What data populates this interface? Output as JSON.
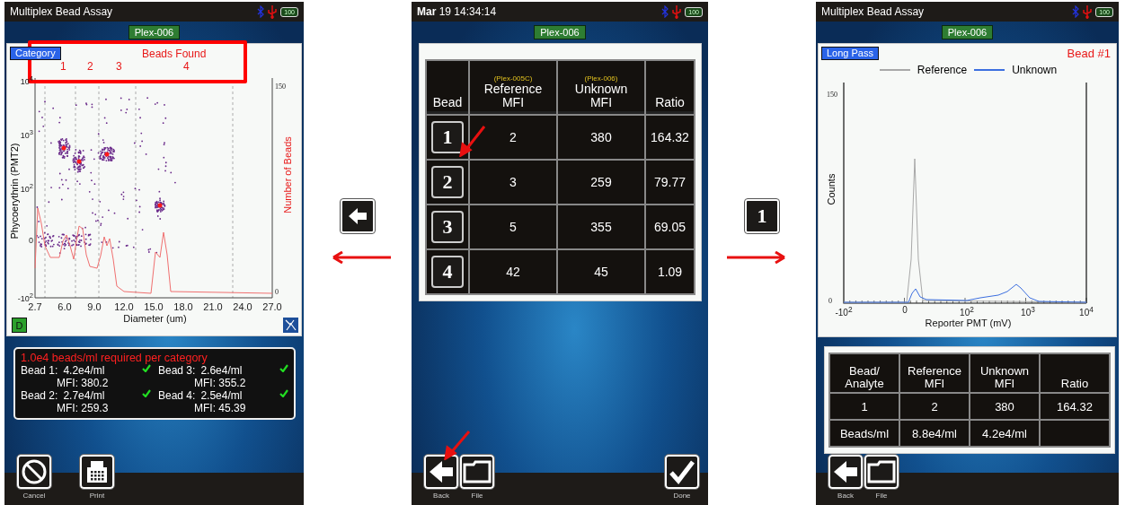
{
  "left_screen": {
    "status_bar": {
      "title": "Multiplex Bead Assay",
      "battery": "100"
    },
    "tag": "Plex-006",
    "plot": {
      "mode_button": "Category",
      "beads_found_label": "Beads Found",
      "bead_markers": [
        "1",
        "2",
        "3",
        "4"
      ],
      "y_label": "Phycoerythrin (PMT2)",
      "y_ticks": [
        "10$^{4}$",
        "10$^{3}$",
        "10$^{2}$",
        "0",
        "-10$^{2}$"
      ],
      "right_label": "Number of Beads",
      "right_ticks": [
        "150",
        "0"
      ],
      "x_ticks": [
        "2.7",
        "6.0",
        "9.0",
        "12.0",
        "15.0",
        "18.0",
        "21.0",
        "24.0",
        "27.0"
      ],
      "x_label": "Diameter (um)",
      "d_button": "D"
    },
    "summary": {
      "requirement": "1.0e4 beads/ml required per category",
      "beads": [
        {
          "label": "Bead 1:",
          "concentration": "4.2e4/ml",
          "mfi": "MFI: 380.2",
          "ok": true
        },
        {
          "label": "Bead 3:",
          "concentration": "2.6e4/ml",
          "mfi": "MFI: 355.2",
          "ok": true
        },
        {
          "label": "Bead 2:",
          "concentration": "2.7e4/ml",
          "mfi": "MFI: 259.3",
          "ok": true
        },
        {
          "label": "Bead 4:",
          "concentration": "2.5e4/ml",
          "mfi": "MFI: 45.39",
          "ok": true
        }
      ]
    },
    "toolbar": [
      {
        "kind": "cancel",
        "label": "Cancel"
      },
      {
        "kind": "print",
        "label": "Print"
      }
    ]
  },
  "connectors": [
    {
      "kind": "back"
    },
    {
      "kind": "number",
      "label": "1"
    }
  ],
  "middle_screen": {
    "status_bar": {
      "title": "**Mar** 19 14:34:14",
      "battery": "100"
    },
    "tag": "Plex-006",
    "table": {
      "columns": [
        {
          "title": "Bead"
        },
        {
          "sublabel": "(Plex-005C)",
          "title": "Reference MFI"
        },
        {
          "sublabel": "(Plex-006)",
          "title": "Unknown MFI"
        },
        {
          "title": "Ratio"
        }
      ],
      "rows": [
        {
          "bead": "1",
          "reference": "2",
          "unknown": "380",
          "ratio": "164.32"
        },
        {
          "bead": "2",
          "reference": "3",
          "unknown": "259",
          "ratio": "79.77"
        },
        {
          "bead": "3",
          "reference": "5",
          "unknown": "355",
          "ratio": "69.05"
        },
        {
          "bead": "4",
          "reference": "42",
          "unknown": "45",
          "ratio": "1.09"
        }
      ]
    },
    "toolbar": [
      {
        "kind": "back",
        "label": "Back"
      },
      {
        "kind": "file",
        "label": "File"
      },
      {
        "kind": "done",
        "label": "Done"
      }
    ]
  },
  "right_screen": {
    "status_bar": {
      "title": "Multiplex Bead Assay",
      "battery": "100"
    },
    "tag": "Plex-006",
    "plot": {
      "mode_button": "Long Pass",
      "bead_label": "Bead #1",
      "legend": [
        {
          "name": "Reference",
          "color": "#a8a8a8"
        },
        {
          "name": "Unknown",
          "color": "#3c6fe0"
        }
      ],
      "y_label": "Counts",
      "y_ticks": [
        "150",
        "0"
      ],
      "x_ticks": [
        "-10$^{2}$",
        "0",
        "10$^{2}$",
        "10$^{3}$",
        "10$^{4}$"
      ],
      "x_label": "Reporter PMT (mV)"
    },
    "table": {
      "columns": [
        "Bead/ Analyte",
        "Reference MFI",
        "Unknown MFI",
        "Ratio"
      ],
      "rows": [
        [
          "1",
          "2",
          "380",
          "164.32"
        ],
        [
          "Beads/ml",
          "8.8e4/ml",
          "4.2e4/ml"
        ]
      ]
    },
    "toolbar": [
      {
        "kind": "back",
        "label": "Back"
      },
      {
        "kind": "file",
        "label": "File"
      }
    ]
  }
}
